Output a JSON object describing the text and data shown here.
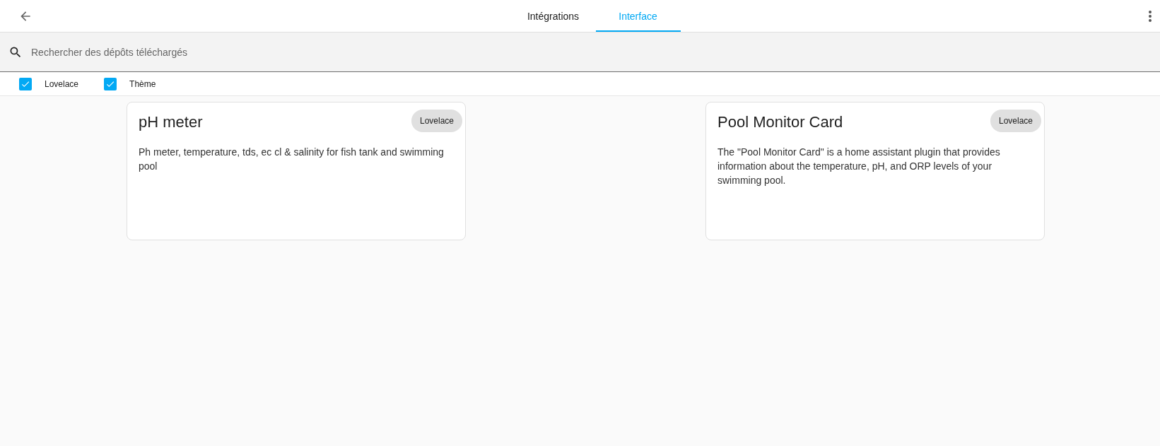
{
  "tabs": [
    {
      "label": "Intégrations",
      "selected": false
    },
    {
      "label": "Interface",
      "selected": true
    }
  ],
  "search": {
    "placeholder": "Rechercher des dépôts téléchargés"
  },
  "filters": [
    {
      "label": "Lovelace",
      "checked": true
    },
    {
      "label": "Thème",
      "checked": true
    }
  ],
  "cards": [
    {
      "title": "pH meter",
      "tag": "Lovelace",
      "description": "Ph meter, temperature, tds, ec cl & salinity for fish tank and swimming pool"
    },
    {
      "title": "Pool Monitor Card",
      "tag": "Lovelace",
      "description": "The \"Pool Monitor Card\" is a home assistant plugin that provides information about the temperature, pH, and ORP levels of your swimming pool."
    }
  ]
}
